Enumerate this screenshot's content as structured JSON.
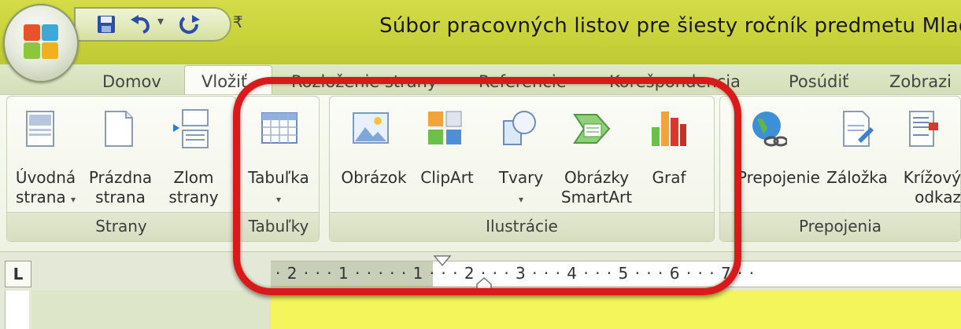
{
  "window": {
    "title": "Súbor pracovných listov pre šiesty ročník predmetu Mladý"
  },
  "quick_access": {
    "icons": [
      "save-icon",
      "undo-icon",
      "dropdown-icon",
      "redo-icon",
      "customize-icon"
    ],
    "undo_dropdown": "▾",
    "customize": "₹"
  },
  "tabs": [
    {
      "label": "Domov"
    },
    {
      "label": "Vložiť"
    },
    {
      "label": "Rozloženie strany"
    },
    {
      "label": "Referencie"
    },
    {
      "label": "Korešpondencia"
    },
    {
      "label": "Posúdiť"
    },
    {
      "label": "Zobrazi"
    }
  ],
  "groups": {
    "strany": {
      "title": "Strany",
      "buttons": [
        {
          "line1": "Úvodná",
          "line2": "strana",
          "arrow": "▾",
          "icon": "cover-page-icon"
        },
        {
          "line1": "Prázdna",
          "line2": "strana",
          "icon": "blank-page-icon"
        },
        {
          "line1": "Zlom",
          "line2": "strany",
          "icon": "page-break-icon"
        }
      ]
    },
    "tabulky": {
      "title": "Tabuľky",
      "buttons": [
        {
          "line1": "Tabuľka",
          "arrow": "▾",
          "icon": "table-icon"
        }
      ]
    },
    "ilustracie": {
      "title": "Ilustrácie",
      "buttons": [
        {
          "line1": "Obrázok",
          "icon": "picture-icon"
        },
        {
          "line1": "ClipArt",
          "icon": "clipart-icon"
        },
        {
          "line1": "Tvary",
          "arrow": "▾",
          "icon": "shapes-icon"
        },
        {
          "line1": "Obrázky",
          "line2": "SmartArt",
          "icon": "smartart-icon"
        },
        {
          "line1": "Graf",
          "icon": "chart-icon"
        }
      ]
    },
    "prepojenia": {
      "title": "Prepojenia",
      "buttons": [
        {
          "line1": "Prepojenie",
          "icon": "hyperlink-icon"
        },
        {
          "line1": "Záložka",
          "icon": "bookmark-icon"
        },
        {
          "line1": "Krížový",
          "line2": "odkaz",
          "icon": "cross-reference-icon"
        }
      ]
    }
  },
  "ruler": {
    "corner": "L",
    "text": "· 2 · · · 1 · · ·    · · 1 · · · 2 · · · 3 · · · 4 · · · 5 · · · 6 · · · 7 · ·"
  },
  "colors": {
    "highlight": "#d91a1a",
    "titlebar": "#c9d33a",
    "page": "#f3f55b"
  }
}
